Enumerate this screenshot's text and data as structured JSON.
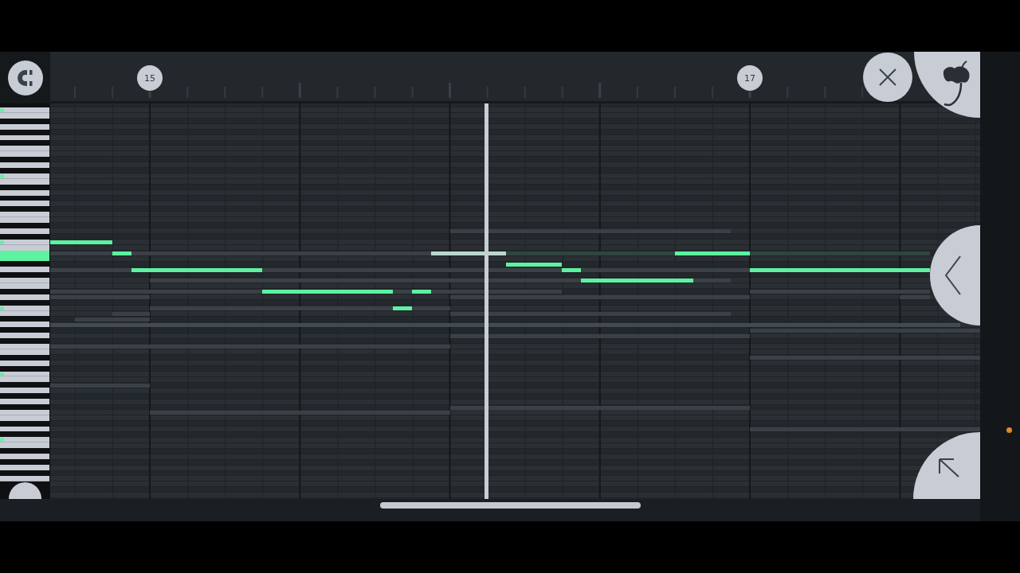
{
  "ruler": {
    "bar_markers": [
      {
        "label": "15"
      },
      {
        "label": "17"
      }
    ]
  },
  "notes": [
    {
      "playing": false
    },
    {
      "playing": false
    },
    {
      "playing": false
    },
    {
      "playing": false
    },
    {
      "playing": false
    },
    {
      "playing": false
    },
    {
      "playing": true
    },
    {
      "playing": false
    },
    {
      "playing": false
    },
    {
      "playing": false
    },
    {
      "playing": false
    },
    {
      "playing": false
    }
  ]
}
